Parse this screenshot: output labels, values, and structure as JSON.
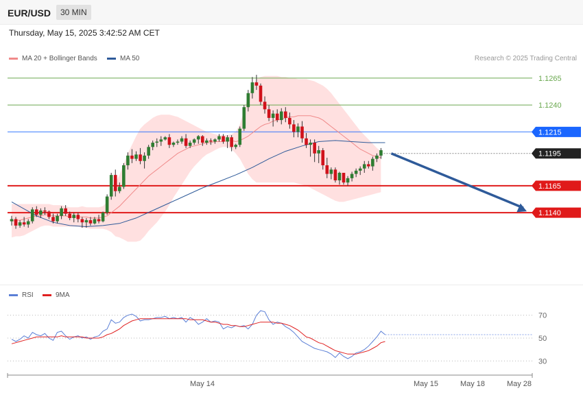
{
  "header": {
    "symbol": "EUR/USD",
    "timeframe": "30 MIN",
    "datetime": "Thursday, May 15, 2025 3:42:52 AM CET"
  },
  "legend": {
    "price": [
      {
        "label": "MA 20 + Bollinger Bands",
        "color": "#f08a8a"
      },
      {
        "label": "MA 50",
        "color": "#2e5a99"
      }
    ],
    "rsi": [
      {
        "label": "RSI",
        "color": "#5b7fd6"
      },
      {
        "label": "9MA",
        "color": "#e02020"
      }
    ],
    "credit": "Research © 2025 Trading Central"
  },
  "colors": {
    "up": "#2f7d32",
    "down": "#d0121b",
    "band": "#ffd6d6",
    "ma20": "#f08a8a",
    "ma50": "#2e5a99",
    "resistance1": "#6aa84f",
    "resistance2": "#1a66ff",
    "support": "#e01a1a",
    "arrow": "#2e5a99",
    "current": "#222222"
  },
  "chart_data": [
    {
      "type": "candlestick",
      "ylim": [
        1.107,
        1.1277
      ],
      "levels": [
        {
          "value": 1.1265,
          "label": "1.1265",
          "kind": "resistance-thin"
        },
        {
          "value": 1.124,
          "label": "1.1240",
          "kind": "resistance-thin"
        },
        {
          "value": 1.1215,
          "label": "1.1215",
          "kind": "pivot"
        },
        {
          "value": 1.1195,
          "label": "1.1195",
          "kind": "current"
        },
        {
          "value": 1.1165,
          "label": "1.1165",
          "kind": "support"
        },
        {
          "value": 1.114,
          "label": "1.1140",
          "kind": "support"
        }
      ],
      "projection": {
        "from_value": 1.1195,
        "to_value": 1.114
      },
      "candles": [
        [
          1.1132,
          1.1137,
          1.1128,
          1.1134
        ],
        [
          1.1134,
          1.1136,
          1.1125,
          1.1128
        ],
        [
          1.1128,
          1.1133,
          1.1126,
          1.1131
        ],
        [
          1.1131,
          1.1136,
          1.1127,
          1.1129
        ],
        [
          1.1129,
          1.1134,
          1.1126,
          1.1132
        ],
        [
          1.1132,
          1.1145,
          1.113,
          1.1143
        ],
        [
          1.1143,
          1.1146,
          1.1136,
          1.1138
        ],
        [
          1.1138,
          1.1144,
          1.1135,
          1.1142
        ],
        [
          1.1142,
          1.1145,
          1.1138,
          1.1141
        ],
        [
          1.1141,
          1.1142,
          1.1134,
          1.1136
        ],
        [
          1.1136,
          1.1139,
          1.113,
          1.1132
        ],
        [
          1.1132,
          1.1139,
          1.113,
          1.1137
        ],
        [
          1.1137,
          1.1146,
          1.1134,
          1.1144
        ],
        [
          1.1144,
          1.1147,
          1.1137,
          1.1139
        ],
        [
          1.1139,
          1.1141,
          1.1133,
          1.1135
        ],
        [
          1.1135,
          1.114,
          1.1131,
          1.1138
        ],
        [
          1.1138,
          1.114,
          1.1131,
          1.1134
        ],
        [
          1.1134,
          1.1136,
          1.1126,
          1.1131
        ],
        [
          1.1131,
          1.1135,
          1.1126,
          1.1133
        ],
        [
          1.1133,
          1.1136,
          1.1128,
          1.113
        ],
        [
          1.113,
          1.1136,
          1.1129,
          1.1134
        ],
        [
          1.1134,
          1.1138,
          1.113,
          1.1132
        ],
        [
          1.1132,
          1.1141,
          1.1131,
          1.114
        ],
        [
          1.114,
          1.1157,
          1.1138,
          1.1155
        ],
        [
          1.1155,
          1.1177,
          1.1152,
          1.1175
        ],
        [
          1.1175,
          1.118,
          1.1155,
          1.116
        ],
        [
          1.116,
          1.1168,
          1.1158,
          1.1164
        ],
        [
          1.1164,
          1.1186,
          1.1162,
          1.1184
        ],
        [
          1.1184,
          1.1196,
          1.118,
          1.1193
        ],
        [
          1.1193,
          1.1199,
          1.1186,
          1.119
        ],
        [
          1.119,
          1.1197,
          1.1188,
          1.1194
        ],
        [
          1.1194,
          1.12,
          1.1185,
          1.1188
        ],
        [
          1.1188,
          1.1196,
          1.1181,
          1.1193
        ],
        [
          1.1193,
          1.1203,
          1.119,
          1.1201
        ],
        [
          1.1201,
          1.1207,
          1.1198,
          1.1205
        ],
        [
          1.1205,
          1.1209,
          1.1201,
          1.1206
        ],
        [
          1.1206,
          1.1211,
          1.1202,
          1.1208
        ],
        [
          1.1208,
          1.1211,
          1.1207,
          1.121
        ],
        [
          1.121,
          1.1213,
          1.12,
          1.1203
        ],
        [
          1.1203,
          1.1206,
          1.1201,
          1.1205
        ],
        [
          1.1205,
          1.1208,
          1.1203,
          1.1206
        ],
        [
          1.1206,
          1.1211,
          1.1204,
          1.1209
        ],
        [
          1.1209,
          1.1213,
          1.12,
          1.1202
        ],
        [
          1.1202,
          1.1207,
          1.12,
          1.1205
        ],
        [
          1.1205,
          1.1209,
          1.1203,
          1.1208
        ],
        [
          1.1208,
          1.1212,
          1.1204,
          1.1211
        ],
        [
          1.1211,
          1.1212,
          1.1202,
          1.1205
        ],
        [
          1.1205,
          1.1209,
          1.1203,
          1.1207
        ],
        [
          1.1207,
          1.1209,
          1.1203,
          1.1206
        ],
        [
          1.1206,
          1.1209,
          1.1204,
          1.1208
        ],
        [
          1.1208,
          1.1213,
          1.1206,
          1.1211
        ],
        [
          1.1211,
          1.1213,
          1.1204,
          1.1206
        ],
        [
          1.1206,
          1.1212,
          1.12,
          1.121
        ],
        [
          1.121,
          1.1212,
          1.1197,
          1.1201
        ],
        [
          1.1201,
          1.1204,
          1.1199,
          1.1203
        ],
        [
          1.1203,
          1.122,
          1.1201,
          1.1218
        ],
        [
          1.1218,
          1.124,
          1.1216,
          1.1238
        ],
        [
          1.1238,
          1.1254,
          1.1234,
          1.1251
        ],
        [
          1.1251,
          1.1266,
          1.1246,
          1.1261
        ],
        [
          1.1261,
          1.1268,
          1.1254,
          1.1258
        ],
        [
          1.1258,
          1.126,
          1.124,
          1.1243
        ],
        [
          1.1243,
          1.1248,
          1.1232,
          1.1236
        ],
        [
          1.1236,
          1.124,
          1.1225,
          1.1228
        ],
        [
          1.1228,
          1.1235,
          1.122,
          1.1232
        ],
        [
          1.1232,
          1.1236,
          1.1224,
          1.1226
        ],
        [
          1.1226,
          1.1237,
          1.1222,
          1.1234
        ],
        [
          1.1234,
          1.1238,
          1.1224,
          1.1228
        ],
        [
          1.1228,
          1.1233,
          1.1218,
          1.1222
        ],
        [
          1.1222,
          1.1226,
          1.121,
          1.1215
        ],
        [
          1.1215,
          1.1223,
          1.121,
          1.122
        ],
        [
          1.122,
          1.1225,
          1.1205,
          1.1209
        ],
        [
          1.1209,
          1.1214,
          1.12,
          1.1203
        ],
        [
          1.1203,
          1.1208,
          1.1192,
          1.1205
        ],
        [
          1.1205,
          1.1208,
          1.1187,
          1.1195
        ],
        [
          1.1195,
          1.1202,
          1.1186,
          1.1198
        ],
        [
          1.1198,
          1.12,
          1.118,
          1.1184
        ],
        [
          1.1184,
          1.1191,
          1.1172,
          1.1176
        ],
        [
          1.1176,
          1.1182,
          1.1171,
          1.118
        ],
        [
          1.118,
          1.1182,
          1.1168,
          1.117
        ],
        [
          1.117,
          1.1178,
          1.1166,
          1.1177
        ],
        [
          1.1177,
          1.1176,
          1.1166,
          1.1168
        ],
        [
          1.1168,
          1.1174,
          1.1165,
          1.1172
        ],
        [
          1.1172,
          1.1178,
          1.1169,
          1.1176
        ],
        [
          1.1176,
          1.1181,
          1.1173,
          1.1179
        ],
        [
          1.1179,
          1.1183,
          1.1175,
          1.1181
        ],
        [
          1.1181,
          1.1188,
          1.1177,
          1.1185
        ],
        [
          1.1185,
          1.1188,
          1.1181,
          1.1183
        ],
        [
          1.1183,
          1.1192,
          1.1179,
          1.119
        ],
        [
          1.119,
          1.1195,
          1.1187,
          1.1193
        ],
        [
          1.1193,
          1.12,
          1.119,
          1.1198
        ]
      ],
      "ma20": [
        1.1132,
        1.1133,
        1.1133,
        1.1134,
        1.1135,
        1.1136,
        1.1137,
        1.1137,
        1.1138,
        1.1138,
        1.1137,
        1.1137,
        1.1137,
        1.1137,
        1.1136,
        1.1136,
        1.1136,
        1.1136,
        1.1136,
        1.1135,
        1.1135,
        1.1135,
        1.1136,
        1.1137,
        1.114,
        1.1143,
        1.1146,
        1.115,
        1.1154,
        1.1158,
        1.1162,
        1.1166,
        1.117,
        1.1174,
        1.1177,
        1.118,
        1.1183,
        1.1186,
        1.1189,
        1.1192,
        1.1195,
        1.1197,
        1.1199,
        1.1201,
        1.1202,
        1.1203,
        1.1204,
        1.1205,
        1.1205,
        1.1206,
        1.1206,
        1.1206,
        1.1207,
        1.1207,
        1.1206,
        1.1207,
        1.1209,
        1.1211,
        1.1214,
        1.1217,
        1.122,
        1.1222,
        1.1223,
        1.1225,
        1.1226,
        1.1227,
        1.1228,
        1.1229,
        1.1229,
        1.123,
        1.123,
        1.123,
        1.123,
        1.1229,
        1.1228,
        1.1226,
        1.1223,
        1.122,
        1.1217,
        1.1214,
        1.1211,
        1.1208,
        1.1205,
        1.1202,
        1.1199,
        1.1197,
        1.1195,
        1.1193,
        1.1192,
        1.1191
      ],
      "band_upper": [
        1.1148,
        1.1148,
        1.1148,
        1.1148,
        1.1148,
        1.1148,
        1.1148,
        1.1148,
        1.1148,
        1.1148,
        1.1147,
        1.1147,
        1.1147,
        1.1146,
        1.1145,
        1.1145,
        1.1145,
        1.1146,
        1.1145,
        1.1145,
        1.1145,
        1.1145,
        1.1146,
        1.115,
        1.1158,
        1.1168,
        1.1175,
        1.1185,
        1.1195,
        1.1203,
        1.1211,
        1.1218,
        1.1222,
        1.1225,
        1.1228,
        1.123,
        1.1231,
        1.1231,
        1.1231,
        1.123,
        1.1229,
        1.1227,
        1.1225,
        1.1223,
        1.1221,
        1.1219,
        1.1217,
        1.1215,
        1.1214,
        1.1213,
        1.1212,
        1.1212,
        1.1212,
        1.1213,
        1.1215,
        1.1222,
        1.1235,
        1.1248,
        1.1258,
        1.1264,
        1.1266,
        1.1267,
        1.1267,
        1.1267,
        1.1267,
        1.1266,
        1.1266,
        1.1265,
        1.1265,
        1.1264,
        1.1264,
        1.1264,
        1.1263,
        1.1262,
        1.126,
        1.1258,
        1.1255,
        1.1251,
        1.1246,
        1.1241,
        1.1236,
        1.1231,
        1.1226,
        1.1221,
        1.1216,
        1.1212,
        1.1208,
        1.1204,
        1.12,
        1.1197
      ],
      "band_lower": [
        1.1117,
        1.1118,
        1.1118,
        1.1119,
        1.1121,
        1.1123,
        1.1125,
        1.1127,
        1.1128,
        1.1128,
        1.1127,
        1.1127,
        1.1127,
        1.1127,
        1.1127,
        1.1127,
        1.1127,
        1.1126,
        1.1126,
        1.1125,
        1.1125,
        1.1125,
        1.1125,
        1.1124,
        1.1122,
        1.1118,
        1.1117,
        1.1115,
        1.1113,
        1.1113,
        1.1113,
        1.1114,
        1.1118,
        1.1123,
        1.1127,
        1.1131,
        1.1136,
        1.1141,
        1.1147,
        1.1154,
        1.116,
        1.1166,
        1.1172,
        1.1178,
        1.1183,
        1.1187,
        1.1191,
        1.1194,
        1.1196,
        1.1198,
        1.12,
        1.1201,
        1.1201,
        1.1199,
        1.1195,
        1.119,
        1.1183,
        1.1176,
        1.1171,
        1.1168,
        1.1168,
        1.1168,
        1.1168,
        1.1168,
        1.1168,
        1.1168,
        1.1168,
        1.1168,
        1.1168,
        1.1167,
        1.1166,
        1.1165,
        1.1163,
        1.1161,
        1.1159,
        1.1157,
        1.1155,
        1.1153,
        1.1151,
        1.115,
        1.115,
        1.1151,
        1.1152,
        1.1153,
        1.1154,
        1.1155,
        1.1156,
        1.1157,
        1.1158,
        1.1159
      ],
      "ma50_points": [
        [
          0,
          1.115
        ],
        [
          6,
          1.1137
        ],
        [
          10,
          1.1131
        ],
        [
          14,
          1.1128
        ],
        [
          18,
          1.1127
        ],
        [
          22,
          1.1128
        ],
        [
          26,
          1.113
        ],
        [
          30,
          1.1135
        ],
        [
          34,
          1.1142
        ],
        [
          38,
          1.1149
        ],
        [
          42,
          1.1156
        ],
        [
          46,
          1.1163
        ],
        [
          50,
          1.1169
        ],
        [
          54,
          1.1175
        ],
        [
          58,
          1.1182
        ],
        [
          62,
          1.119
        ],
        [
          66,
          1.1197
        ],
        [
          70,
          1.1202
        ],
        [
          74,
          1.1206
        ],
        [
          78,
          1.1207
        ],
        [
          82,
          1.1206
        ],
        [
          86,
          1.1205
        ],
        [
          90,
          1.1205
        ]
      ]
    },
    {
      "type": "line",
      "name": "RSI",
      "ylim": [
        20,
        80
      ],
      "ticks": [
        70,
        50,
        30
      ],
      "series": [
        {
          "name": "RSI",
          "values": [
            49,
            47,
            49,
            52,
            50,
            55,
            53,
            52,
            54,
            50,
            48,
            55,
            56,
            52,
            49,
            51,
            52,
            50,
            51,
            49,
            51,
            52,
            56,
            58,
            66,
            63,
            64,
            68,
            70,
            71,
            69,
            65,
            66,
            66,
            67,
            68,
            68,
            69,
            67,
            68,
            67,
            68,
            64,
            68,
            66,
            62,
            64,
            67,
            64,
            65,
            64,
            58,
            60,
            59,
            61,
            60,
            61,
            58,
            62,
            70,
            74,
            73,
            66,
            62,
            64,
            63,
            60,
            58,
            55,
            51,
            47,
            45,
            43,
            41,
            40,
            39,
            38,
            36,
            33,
            37,
            34,
            32,
            34,
            37,
            38,
            40,
            43,
            47,
            51,
            56,
            53
          ]
        },
        {
          "name": "9MA",
          "values": [
            45,
            46,
            47,
            48,
            49,
            50,
            51,
            51,
            51,
            51,
            51,
            51,
            52,
            51,
            51,
            51,
            51,
            51,
            50,
            50,
            50,
            50,
            51,
            53,
            54,
            56,
            58,
            61,
            63,
            65,
            66,
            67,
            67,
            67,
            67,
            67,
            67,
            67,
            67,
            67,
            67,
            67,
            67,
            66,
            66,
            66,
            66,
            65,
            64,
            64,
            63,
            62,
            62,
            61,
            61,
            60,
            60,
            61,
            62,
            63,
            64,
            64,
            64,
            64,
            63,
            63,
            62,
            61,
            59,
            57,
            54,
            51,
            50,
            48,
            46,
            45,
            43,
            41,
            39,
            38,
            37,
            36,
            36,
            36,
            37,
            38,
            39,
            41,
            43,
            46,
            47
          ]
        }
      ]
    }
  ],
  "xaxis": {
    "labels": [
      "May 14",
      "May 15",
      "May 18",
      "May 28"
    ]
  }
}
